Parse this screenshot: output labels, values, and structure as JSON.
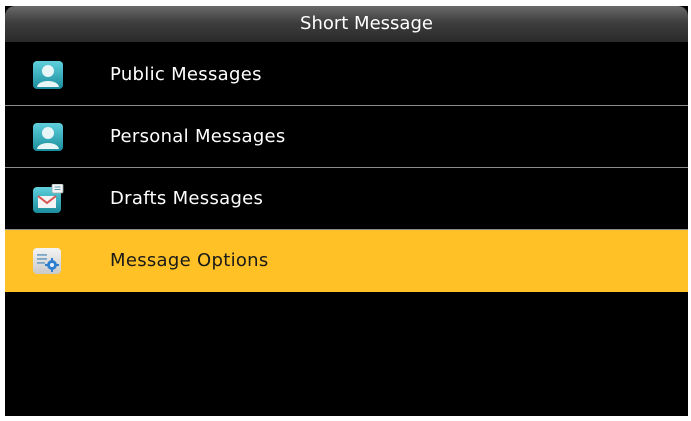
{
  "title": "Short Message",
  "menu": {
    "items": [
      {
        "label": "Public Messages",
        "icon": "public-messages-icon",
        "selected": false
      },
      {
        "label": "Personal Messages",
        "icon": "personal-messages-icon",
        "selected": false
      },
      {
        "label": "Drafts Messages",
        "icon": "drafts-messages-icon",
        "selected": false
      },
      {
        "label": "Message Options",
        "icon": "message-options-icon",
        "selected": true
      }
    ]
  },
  "colors": {
    "background": "#000000",
    "selection": "#ffc125",
    "text": "#ffffff",
    "icon_teal": "#28a8b8"
  }
}
